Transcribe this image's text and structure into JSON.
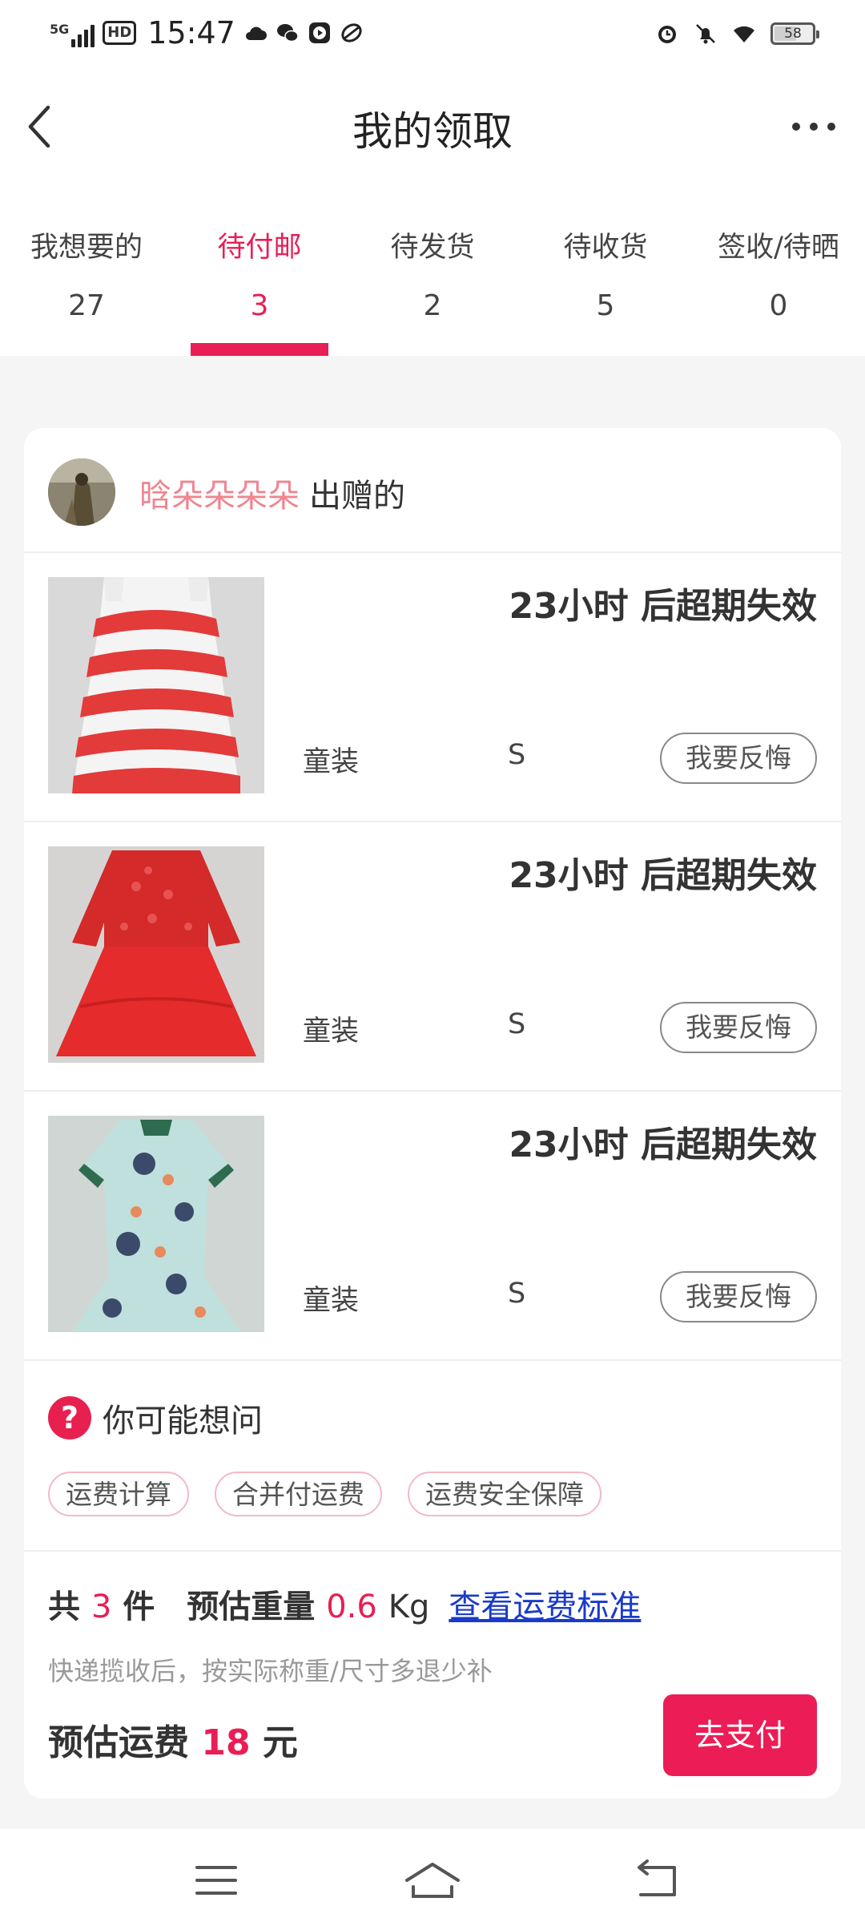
{
  "status_bar": {
    "network": "5G",
    "hd": "HD",
    "time": "15:47",
    "battery": "58",
    "battery_level": 0.58,
    "left_icons": [
      "cloud-icon",
      "wechat-icon",
      "play-icon",
      "leaf-icon"
    ],
    "right_icons": [
      "alarm-icon",
      "mute-icon",
      "wifi-icon",
      "battery-icon"
    ]
  },
  "header": {
    "title": "我的领取",
    "back_icon": "chevron-left-icon",
    "more_icon": "more-icon"
  },
  "tabs": [
    {
      "label": "我想要的",
      "count": "27"
    },
    {
      "label": "待付邮",
      "count": "3",
      "active": true
    },
    {
      "label": "待发货",
      "count": "2"
    },
    {
      "label": "待收货",
      "count": "5"
    },
    {
      "label": "签收/待晒",
      "count": "0"
    }
  ],
  "giver": {
    "name": "晗朵朵朵朵",
    "suffix": "出赠的"
  },
  "items": [
    {
      "expire": "23小时 后超期失效",
      "category": "童装",
      "size": "S",
      "action": "我要反悔",
      "image": "red-white-striped-dress"
    },
    {
      "expire": "23小时 后超期失效",
      "category": "童装",
      "size": "S",
      "action": "我要反悔",
      "image": "red-lace-tulle-dress"
    },
    {
      "expire": "23小时 后超期失效",
      "category": "童装",
      "size": "S",
      "action": "我要反悔",
      "image": "floral-qipao-dress"
    }
  ],
  "faq": {
    "title": "你可能想问",
    "chips": [
      "运费计算",
      "合并付运费",
      "运费安全保障"
    ]
  },
  "summary": {
    "total_prefix": "共",
    "total_count": "3",
    "total_unit": "件",
    "weight_label": "预估重量",
    "weight_value": "0.6",
    "weight_unit": "Kg",
    "link": "查看运费标准",
    "note": "快递揽收后，按实际称重/尺寸多退少补",
    "fee_label": "预估运费",
    "fee_value": "18",
    "fee_unit": "元",
    "pay_button": "去支付"
  },
  "nav": {
    "menu_icon": "menu-icon",
    "home_icon": "home-icon",
    "back_icon": "back-icon"
  },
  "colors": {
    "accent": "#e81e55",
    "giver_name": "#f0858f",
    "link": "#1a3bc9"
  }
}
